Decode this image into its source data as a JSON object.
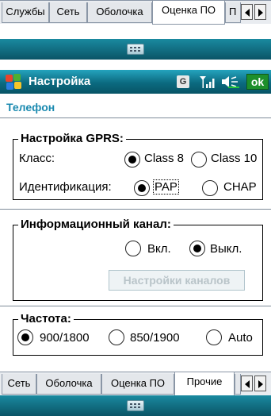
{
  "top_tabs": [
    {
      "label": "Службы",
      "active": false
    },
    {
      "label": "Сеть",
      "active": false
    },
    {
      "label": "Оболочка",
      "active": false
    },
    {
      "label": "Оценка ПО",
      "active": true
    },
    {
      "label": "П",
      "active": false
    }
  ],
  "titlebar": {
    "title": "Настройка",
    "g_icon": "G",
    "ok_label": "ok",
    "icons": [
      "windows-start-icon",
      "g-indicator-icon",
      "signal-icon",
      "speaker-icon"
    ]
  },
  "page_title": "Телефон",
  "gprs": {
    "title": "Настройка GPRS:",
    "class_label": "Класс:",
    "class_options": [
      {
        "label": "Class 8",
        "selected": true
      },
      {
        "label": "Class 10",
        "selected": false
      }
    ],
    "auth_label": "Идентификация:",
    "auth_options": [
      {
        "label": "PAP",
        "selected": true
      },
      {
        "label": "CHAP",
        "selected": false
      }
    ]
  },
  "info_channel": {
    "title": "Информационный канал:",
    "options": [
      {
        "label": "Вкл.",
        "selected": false
      },
      {
        "label": "Выкл.",
        "selected": true
      }
    ],
    "settings_button": "Настройки каналов"
  },
  "frequency": {
    "title": "Частота:",
    "options": [
      {
        "label": "900/1800",
        "selected": true
      },
      {
        "label": "850/1900",
        "selected": false
      },
      {
        "label": "Auto",
        "selected": false
      }
    ]
  },
  "bottom_tabs": [
    {
      "label": "Сеть",
      "active": false
    },
    {
      "label": "Оболочка",
      "active": false
    },
    {
      "label": "Оценка ПО",
      "active": false
    },
    {
      "label": "Прочие",
      "active": true
    }
  ],
  "colors": {
    "accent": "#1a8ab0",
    "titlebar": "#0b6a80",
    "ok_button": "#1d8f2b"
  }
}
